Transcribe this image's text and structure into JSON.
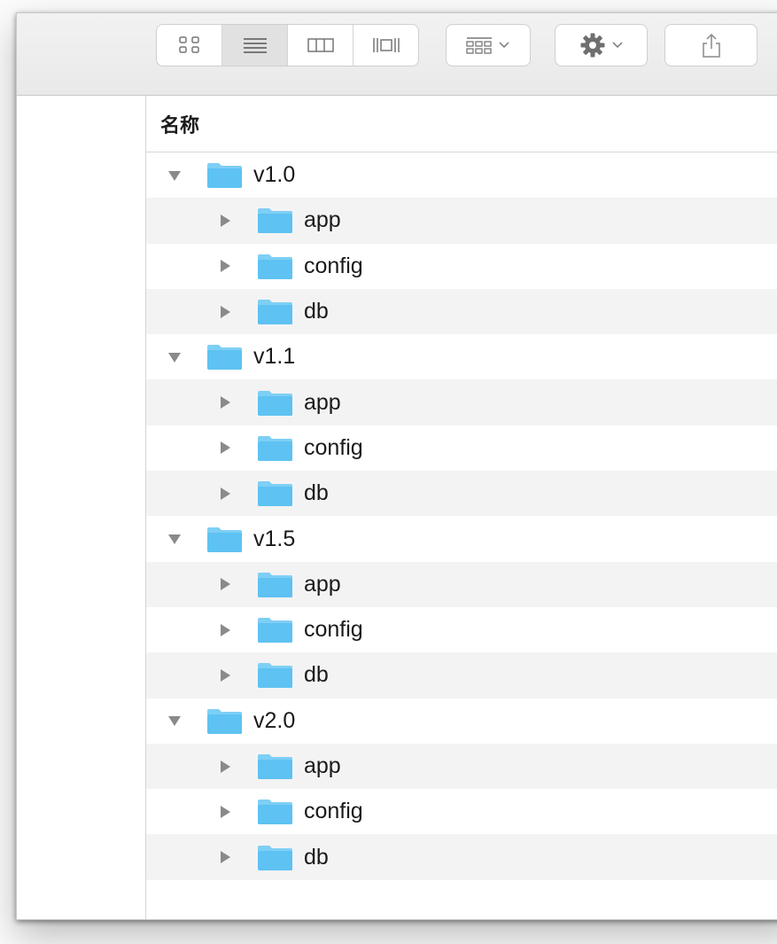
{
  "toolbar": {
    "view_modes": [
      {
        "icon": "icon-view-icon",
        "active": false
      },
      {
        "icon": "list-view-icon",
        "active": true
      },
      {
        "icon": "column-view-icon",
        "active": false
      },
      {
        "icon": "cover-flow-icon",
        "active": false
      }
    ],
    "group_button_icon": "group-by-icon",
    "action_button_icon": "gear-icon",
    "share_button_icon": "share-icon"
  },
  "list": {
    "header": "名称",
    "folders": [
      {
        "name": "v1.0",
        "expanded": true,
        "children": [
          "app",
          "config",
          "db"
        ]
      },
      {
        "name": "v1.1",
        "expanded": true,
        "children": [
          "app",
          "config",
          "db"
        ]
      },
      {
        "name": "v1.5",
        "expanded": true,
        "children": [
          "app",
          "config",
          "db"
        ]
      },
      {
        "name": "v2.0",
        "expanded": true,
        "children": [
          "app",
          "config",
          "db"
        ]
      }
    ]
  },
  "colors": {
    "folder_fill": "#5ec2f2",
    "folder_tab": "#7ecff5",
    "alt_row": "#f3f3f3",
    "disclosure": "#8a8a8a"
  }
}
